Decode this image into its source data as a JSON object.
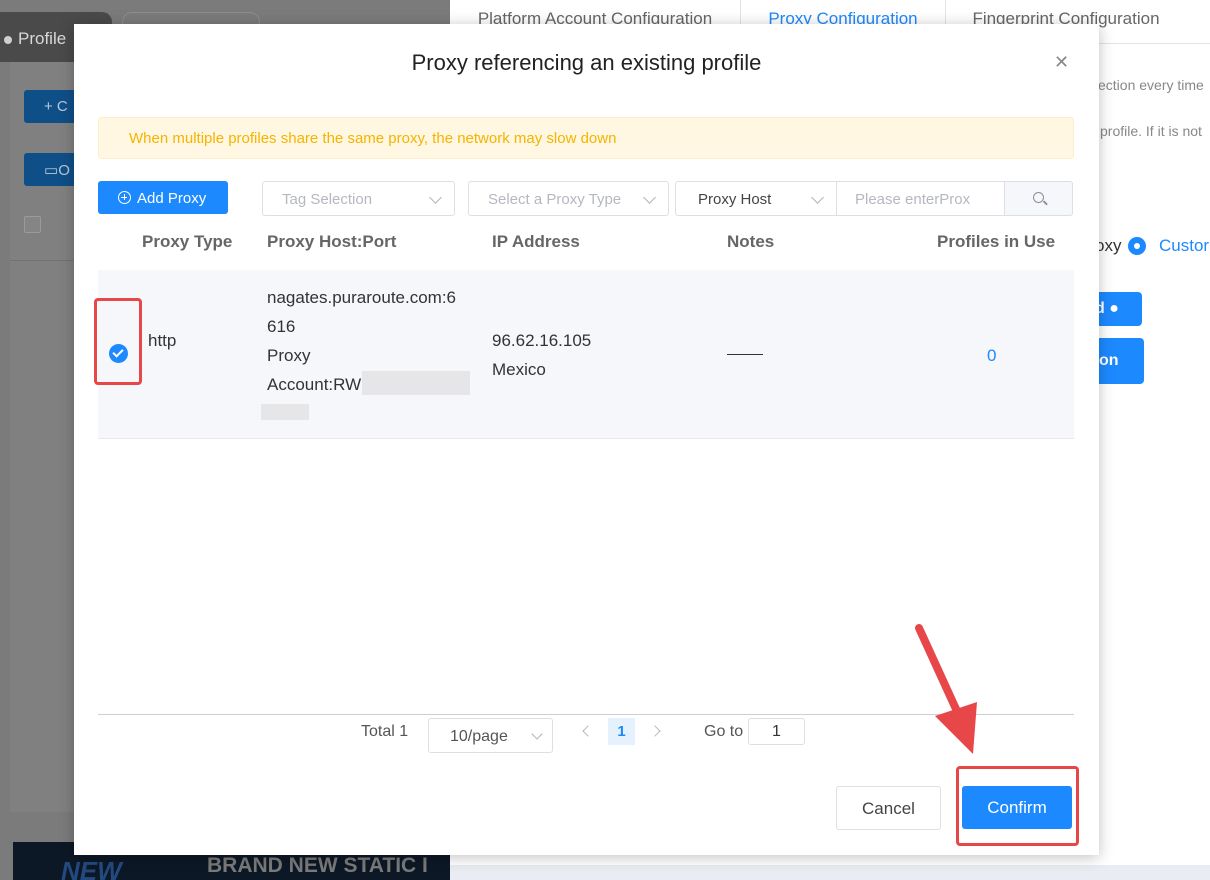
{
  "background_app": {
    "left_tab": "Profile",
    "left_btn_create": "+ C",
    "left_btn_folder": "O",
    "right_tabs": [
      "Platform Account Configuration",
      "Proxy Configuration",
      "Fingerprint Configuration"
    ],
    "right_text_1": "ection every time",
    "right_text_2": "profile. If it is not",
    "radio_label": "oxy",
    "radio_custom": "Custor",
    "btn_partial_1": "d",
    "btn_partial_2": "on",
    "banner_new": "NEW",
    "banner_headline": "BRAND NEW STATIC I"
  },
  "modal": {
    "title": "Proxy referencing an existing profile",
    "alert": "When multiple profiles share the same proxy, the network may slow down",
    "toolbar": {
      "add_proxy": "Add Proxy",
      "tag_placeholder": "Tag Selection",
      "type_placeholder": "Select a Proxy Type",
      "host_select": "Proxy Host",
      "search_placeholder": "Please enterProx"
    },
    "table": {
      "headers": [
        "Proxy Type",
        "Proxy Host:Port",
        "IP Address",
        "Notes",
        "Profiles in Use"
      ],
      "rows": [
        {
          "type": "http",
          "host_line1": "nagates.puraroute.com:6",
          "host_line2": "616",
          "host_line3": "Proxy",
          "host_line4": "Account:RW",
          "ip": "96.62.16.105",
          "country": "Mexico",
          "notes": "——",
          "profiles_in_use": "0",
          "selected": true
        }
      ]
    },
    "pagination": {
      "total": "Total 1",
      "page_size": "10/page",
      "current_page": "1",
      "goto_label": "Go to",
      "goto_value": "1"
    },
    "footer": {
      "cancel": "Cancel",
      "confirm": "Confirm"
    }
  },
  "annotation_color": "#e8474a",
  "accent": "#1d89ff"
}
